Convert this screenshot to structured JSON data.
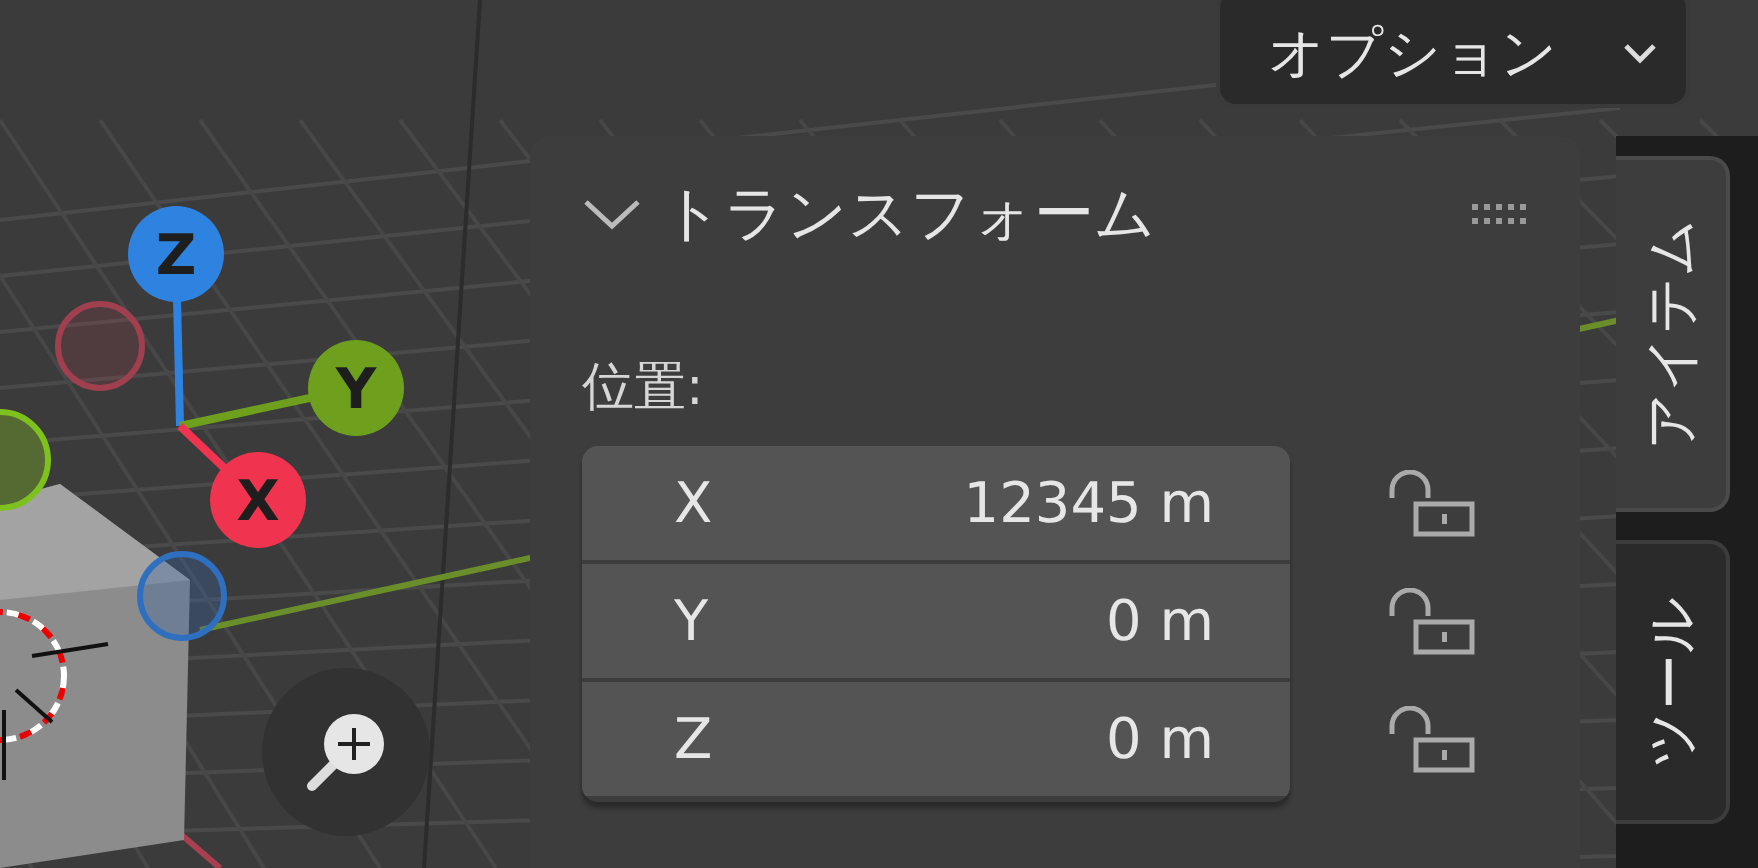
{
  "options_button": {
    "label": "オプション"
  },
  "gizmo": {
    "axes": [
      {
        "label": "Z",
        "color": "#2f83e0"
      },
      {
        "label": "Y",
        "color": "#6ea01e"
      },
      {
        "label": "X",
        "color": "#f0344f"
      }
    ]
  },
  "panel": {
    "title": "トランスフォーム",
    "expanded": true,
    "section_label": "位置:",
    "fields": [
      {
        "axis": "X",
        "value": "12345 m",
        "locked": false
      },
      {
        "axis": "Y",
        "value": "0 m",
        "locked": false
      },
      {
        "axis": "Z",
        "value": "0 m",
        "locked": false
      }
    ]
  },
  "tabs": [
    {
      "label": "アイテム",
      "selected": true
    },
    {
      "label": "ツール",
      "selected": false
    }
  ]
}
